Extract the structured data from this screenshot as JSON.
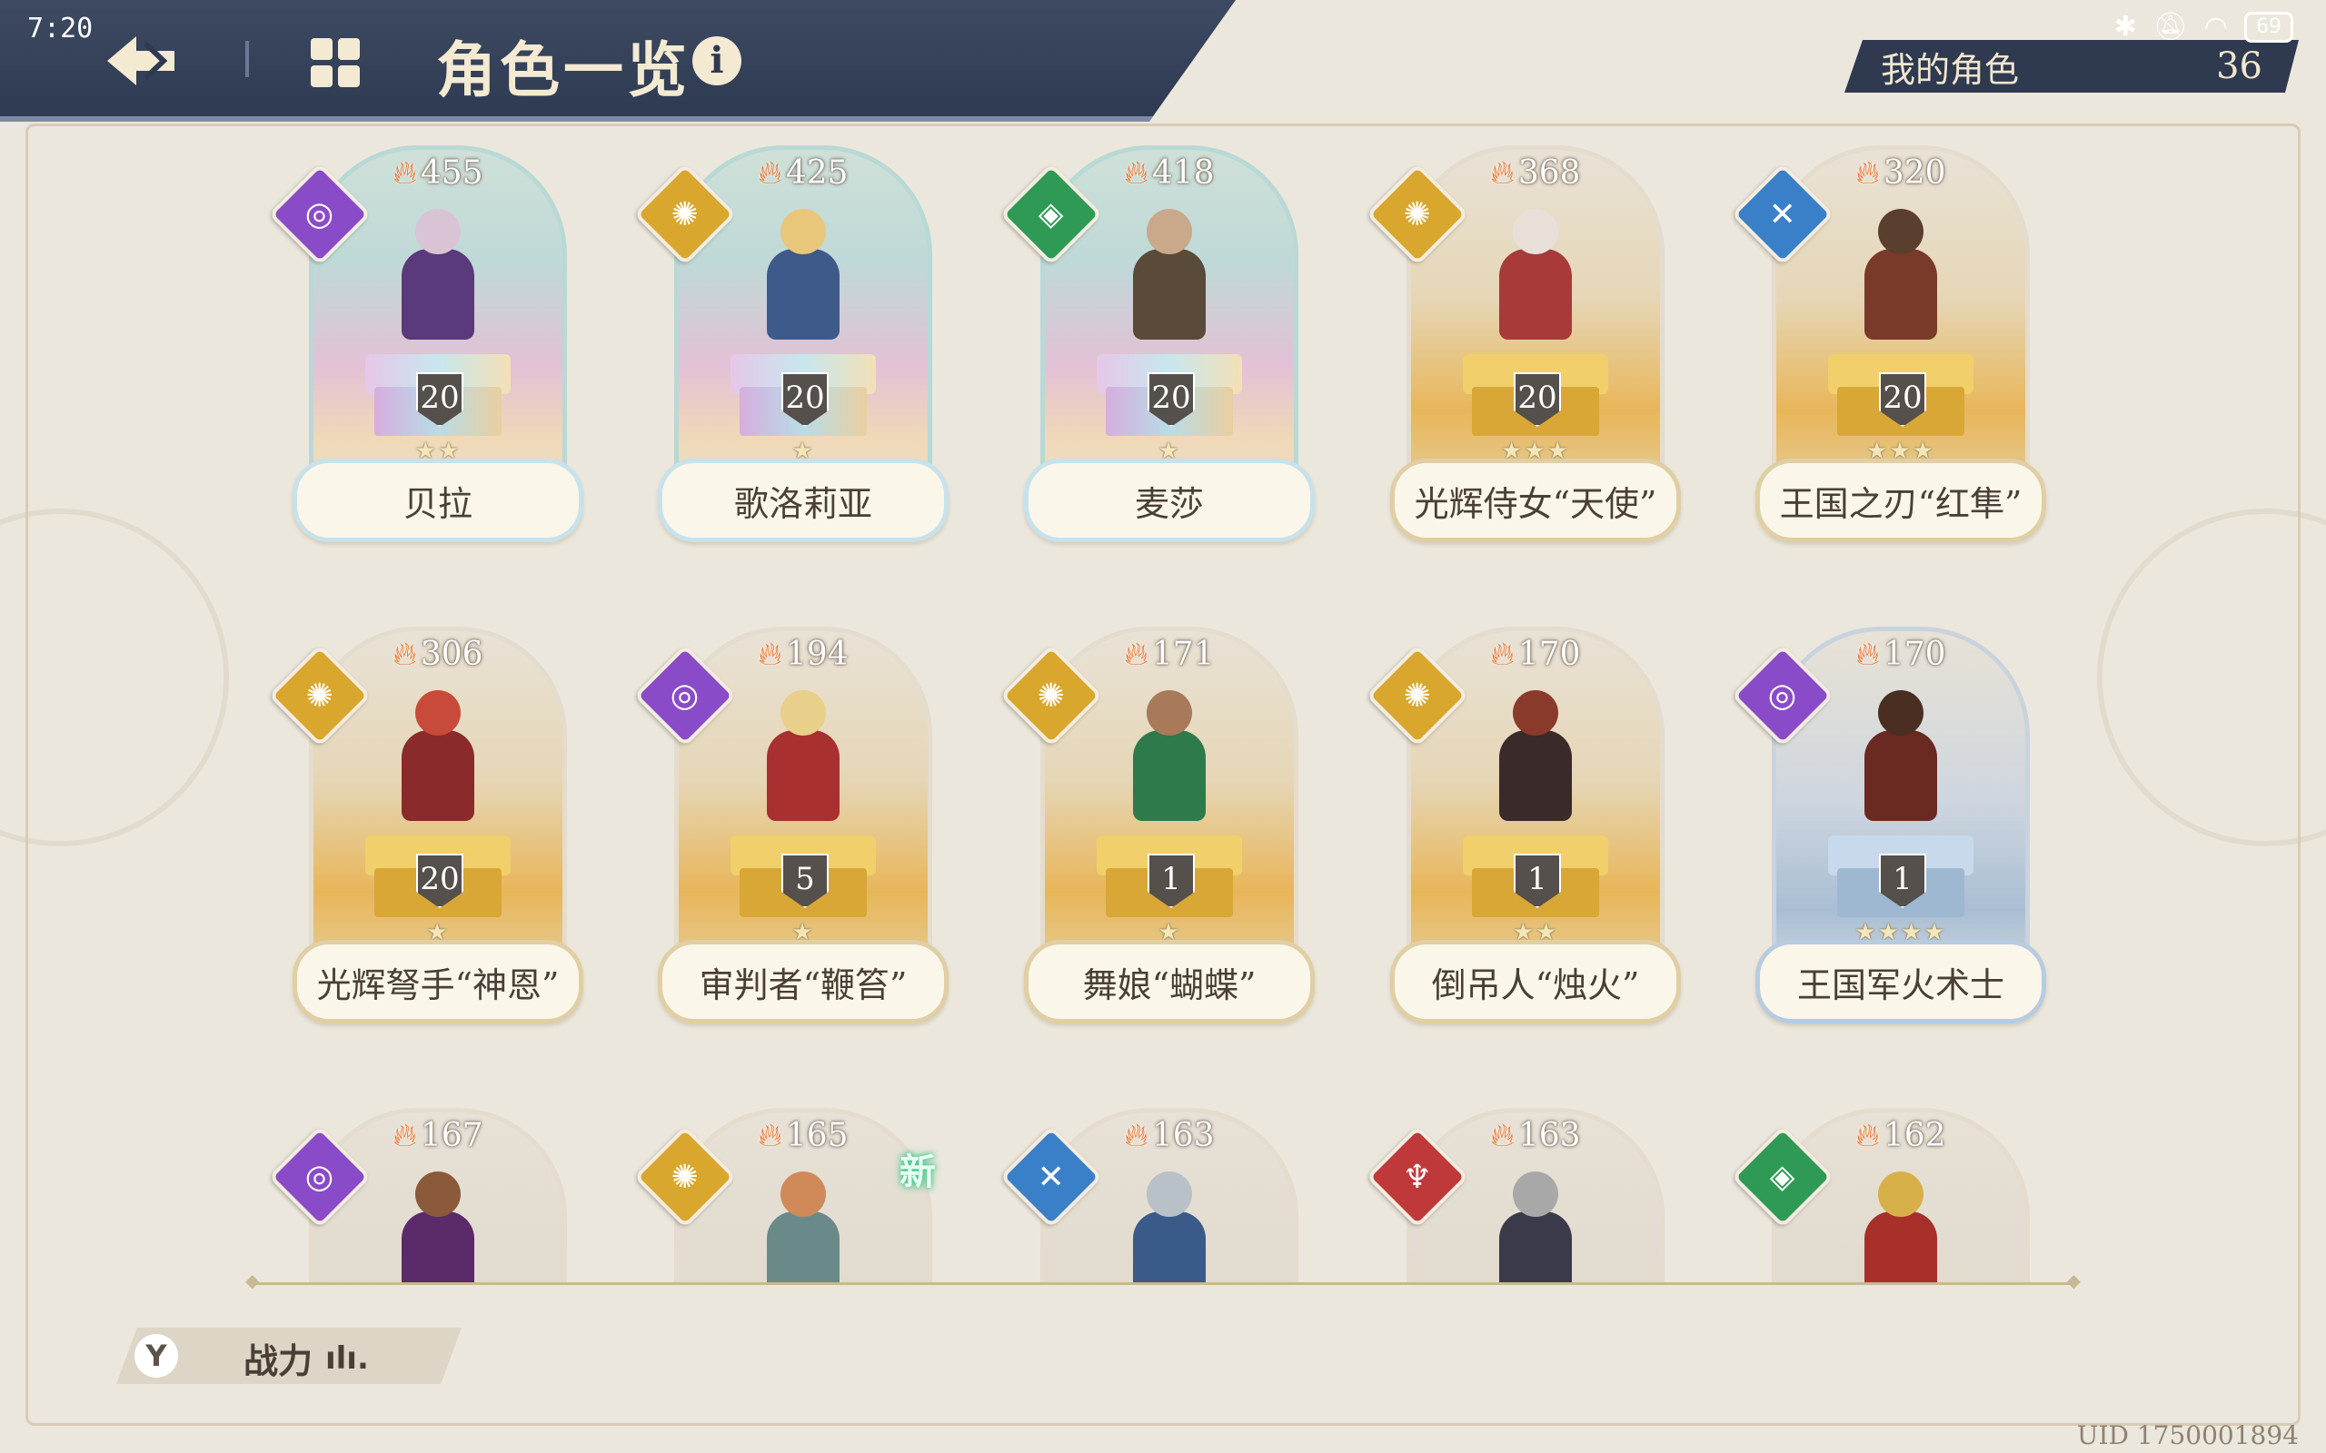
{
  "status_bar": {
    "time": "7:20",
    "battery": "69"
  },
  "header": {
    "title": "角色一览",
    "info": "i"
  },
  "my_characters": {
    "label": "我的角色",
    "count": "36"
  },
  "new_label": "新",
  "sort": {
    "label": "战力"
  },
  "uid": "UID 1750001894",
  "characters": [
    {
      "name": "贝拉",
      "power": "455",
      "level": "20",
      "stars": "★★",
      "element": "arcane",
      "rarity": "rainbow",
      "colors": [
        "#d9c4d6",
        "#5a3a7a"
      ]
    },
    {
      "name": "歌洛莉亚",
      "power": "425",
      "level": "20",
      "stars": "★",
      "element": "light",
      "rarity": "rainbow",
      "colors": [
        "#e8c77a",
        "#3e5a8a"
      ]
    },
    {
      "name": "麦莎",
      "power": "418",
      "level": "20",
      "stars": "★",
      "element": "nature",
      "rarity": "rainbow",
      "colors": [
        "#c9a98a",
        "#5a4a3a"
      ]
    },
    {
      "name": "光辉侍女“天使”",
      "power": "368",
      "level": "20",
      "stars": "★★★",
      "element": "light",
      "rarity": "gold",
      "colors": [
        "#e8e0d8",
        "#a83a3a"
      ]
    },
    {
      "name": "王国之刃“红隼”",
      "power": "320",
      "level": "20",
      "stars": "★★★",
      "element": "ice",
      "rarity": "gold",
      "colors": [
        "#5a3e2e",
        "#7a3a2a"
      ]
    },
    {
      "name": "光辉弩手“神恩”",
      "power": "306",
      "level": "20",
      "stars": "★",
      "element": "light",
      "rarity": "gold",
      "colors": [
        "#c84a3a",
        "#8a2a2a"
      ]
    },
    {
      "name": "审判者“鞭笞”",
      "power": "194",
      "level": "5",
      "stars": "★",
      "element": "arcane",
      "rarity": "gold",
      "colors": [
        "#e8cf8a",
        "#a83030"
      ]
    },
    {
      "name": "舞娘“蝴蝶”",
      "power": "171",
      "level": "1",
      "stars": "★",
      "element": "light",
      "rarity": "gold",
      "colors": [
        "#a87a5a",
        "#2e7a4a"
      ]
    },
    {
      "name": "倒吊人“烛火”",
      "power": "170",
      "level": "1",
      "stars": "★★",
      "element": "light",
      "rarity": "gold",
      "colors": [
        "#8a3a2a",
        "#3a2a2a"
      ]
    },
    {
      "name": "王国军火术士",
      "power": "170",
      "level": "1",
      "stars": "★★★★",
      "element": "arcane",
      "rarity": "blue",
      "colors": [
        "#4a2e22",
        "#6a2a22"
      ]
    },
    {
      "name": "",
      "power": "167",
      "level": "",
      "stars": "",
      "element": "arcane",
      "rarity": "plain",
      "colors": [
        "#8a5a3a",
        "#5a2a6a"
      ]
    },
    {
      "name": "",
      "power": "165",
      "level": "",
      "stars": "",
      "element": "light",
      "rarity": "plain",
      "colors": [
        "#d08a5a",
        "#6a8a8a"
      ]
    },
    {
      "name": "",
      "power": "163",
      "level": "",
      "stars": "",
      "element": "ice",
      "rarity": "plain",
      "colors": [
        "#b8c0c8",
        "#3a5a8a"
      ]
    },
    {
      "name": "",
      "power": "163",
      "level": "",
      "stars": "",
      "element": "fire",
      "rarity": "plain",
      "colors": [
        "#a8a8a8",
        "#3a3a4a"
      ]
    },
    {
      "name": "",
      "power": "162",
      "level": "",
      "stars": "",
      "element": "nature",
      "rarity": "plain",
      "colors": [
        "#d8b04a",
        "#a8302a"
      ]
    }
  ]
}
